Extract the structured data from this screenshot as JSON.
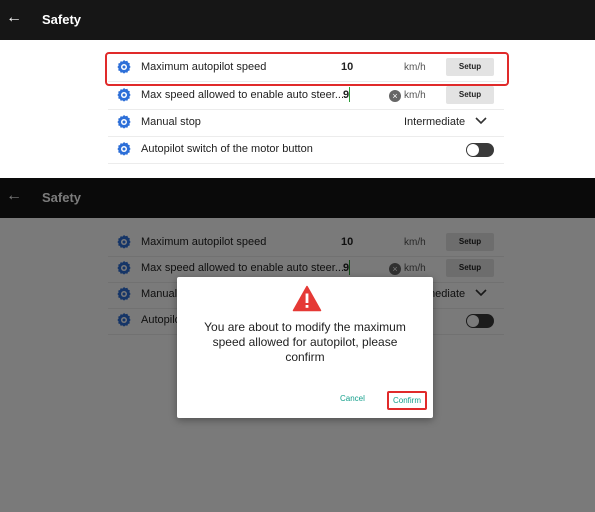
{
  "app": {
    "title": "Safety",
    "back_glyph": "←"
  },
  "settings": [
    {
      "label": "Maximum autopilot speed",
      "value": "10",
      "unit": "km/h",
      "button": "Setup",
      "icon": "settings-gear-icon"
    },
    {
      "label": "Max speed allowed to enable auto steer...",
      "value": "9",
      "unit": "km/h",
      "button": "Setup",
      "icon": "settings-gear-icon",
      "clear_glyph": "×"
    },
    {
      "label": "Manual stop",
      "selected": "Intermediate",
      "icon": "settings-gear-icon"
    },
    {
      "label": "Autopilot switch of the motor button",
      "toggle_on": false,
      "icon": "settings-gear-icon"
    }
  ],
  "dialog": {
    "message": "You are about to modify the maximum speed allowed for autopilot, please confirm",
    "cancel": "Cancel",
    "confirm": "Confirm",
    "icon": "warning-icon"
  },
  "colors": {
    "accent": "#2d6fd8",
    "highlight": "#e02a2a",
    "dialog_button": "#16a08c",
    "warning": "#e53935",
    "appbar": "#161616"
  }
}
